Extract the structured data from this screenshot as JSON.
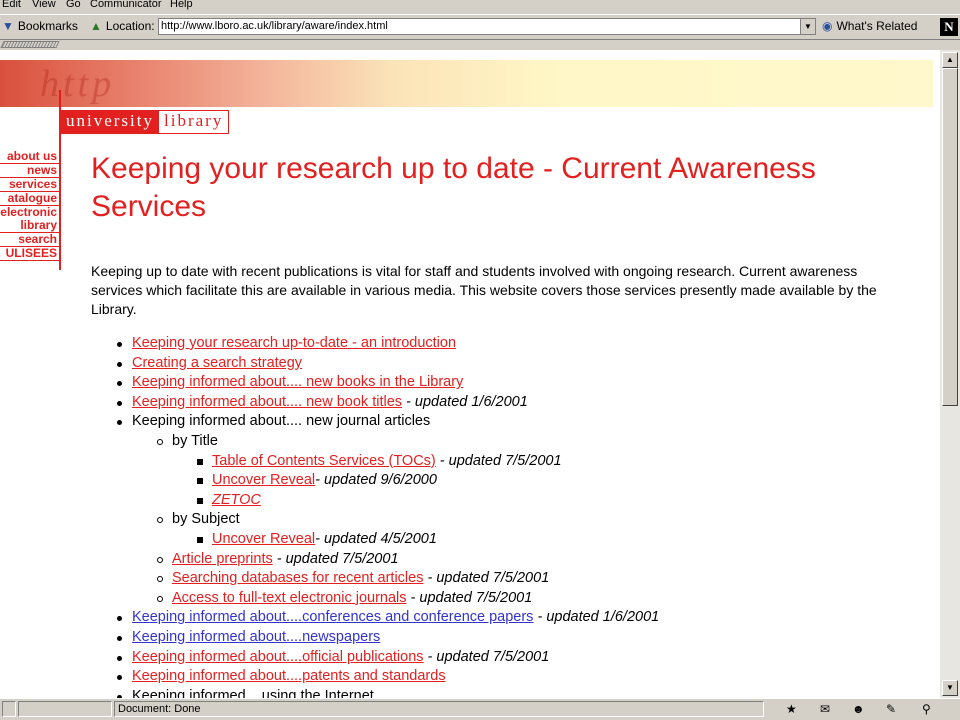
{
  "menu": [
    "Edit",
    "View",
    "Go",
    "Communicator",
    "Help"
  ],
  "toolbar": {
    "bookmarks": "Bookmarks",
    "location_label": "Location:",
    "url": "http://www.lboro.ac.uk/library/aware/index.html",
    "whats_related": "What's Related",
    "netscape_logo": "N"
  },
  "banner": {
    "deco_text": "http"
  },
  "logo": {
    "university": "university",
    "library": "library"
  },
  "sidenav": [
    "about us",
    "news",
    "services",
    "atalogue",
    "electronic",
    "library",
    "search",
    "ULISEES"
  ],
  "page": {
    "title": "Keeping your research up to date - Current Awareness Services",
    "intro": "Keeping up to date with recent publications is vital for staff and students involved with ongoing research. Current awareness services which facilitate this are available in various media. This website covers those services presently made available by the Library."
  },
  "list": [
    {
      "level": 1,
      "link": "Keeping your research up-to-date - an introduction",
      "suffix": ""
    },
    {
      "level": 1,
      "link": "Creating a search strategy",
      "suffix": ""
    },
    {
      "level": 1,
      "link": "Keeping informed about.... new books in the Library",
      "suffix": ""
    },
    {
      "level": 1,
      "link": "Keeping informed about.... new book titles",
      "suffix": " - updated 1/6/2001"
    },
    {
      "level": 1,
      "text": "Keeping informed about.... new journal articles"
    },
    {
      "level": 2,
      "text": "by Title"
    },
    {
      "level": 3,
      "link": "Table of Contents Services (TOCs)",
      "suffix": " - updated 7/5/2001"
    },
    {
      "level": 3,
      "link": "Uncover Reveal",
      "suffix": "- updated 9/6/2000"
    },
    {
      "level": 3,
      "link": "ZETOC",
      "suffix": "",
      "italic": true
    },
    {
      "level": 2,
      "text": "by Subject"
    },
    {
      "level": 3,
      "link": "Uncover Reveal",
      "suffix": "- updated 4/5/2001"
    },
    {
      "level": 2,
      "link": "Article preprints",
      "suffix": " - updated 7/5/2001"
    },
    {
      "level": 2,
      "link": "Searching databases for recent articles",
      "suffix": " - updated 7/5/2001"
    },
    {
      "level": 2,
      "link": "Access to full-text electronic journals",
      "suffix": " - updated 7/5/2001"
    },
    {
      "level": 1,
      "link": "Keeping informed about....conferences and conference papers",
      "suffix": " - updated 1/6/2001",
      "visited": true
    },
    {
      "level": 1,
      "link": "Keeping informed about....newspapers",
      "suffix": "",
      "visited": true
    },
    {
      "level": 1,
      "link": "Keeping informed about....official publications",
      "suffix": " - updated 7/5/2001"
    },
    {
      "level": 1,
      "link": "Keeping informed about....patents and standards",
      "suffix": ""
    },
    {
      "level": 1,
      "text": "Keeping informed....using the Internet"
    }
  ],
  "status": {
    "text": "Document: Done"
  },
  "colors": {
    "accent": "#e22020",
    "visited_link": "#3333cc",
    "chrome": "#d4d0c8"
  }
}
